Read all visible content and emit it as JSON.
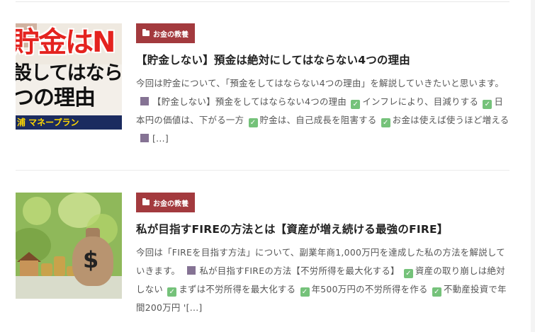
{
  "articles": [
    {
      "category": "お金の教養",
      "title": "【貯金しない】預金は絶対にしてはならない4つの理由",
      "thumb": {
        "line1": "貯金はN",
        "line2": "設してはならな",
        "line3": "つの理由",
        "footer": "浦 マネープラン"
      },
      "excerpt": {
        "intro": "今回は貯金について、「預金をしてはならない4つの理由」を解説していきたいと思います。",
        "heading": "【貯金しない】預金をしてはならない4つの理由",
        "points": [
          "インフレにより、目減りする",
          "日本円の価値は、下がる一方",
          "貯金は、自己成長を阻害する",
          "お金は使えば使うほど増える"
        ],
        "more": "[...]"
      }
    },
    {
      "category": "お金の教養",
      "title": "私が目指すFIREの方法とは【資産が増え続ける最強のFIRE】",
      "thumb": {
        "symbol": "$"
      },
      "excerpt": {
        "intro": "今回は「FIREを目指す方法」について、副業年商1,000万円を達成した私の方法を解説していきます。",
        "heading": "私が目指すFIREの方法【不労所得を最大化する】",
        "points": [
          "資産の取り崩しは絶対しない",
          "まずは不労所得を最大化する",
          "年500万円の不労所得を作る",
          "不動産投資で年間200万円 '"
        ],
        "more": "[...]"
      }
    }
  ],
  "colors": {
    "category_bg": "#a33a3e",
    "check": "#75c27a",
    "square": "#857394"
  }
}
